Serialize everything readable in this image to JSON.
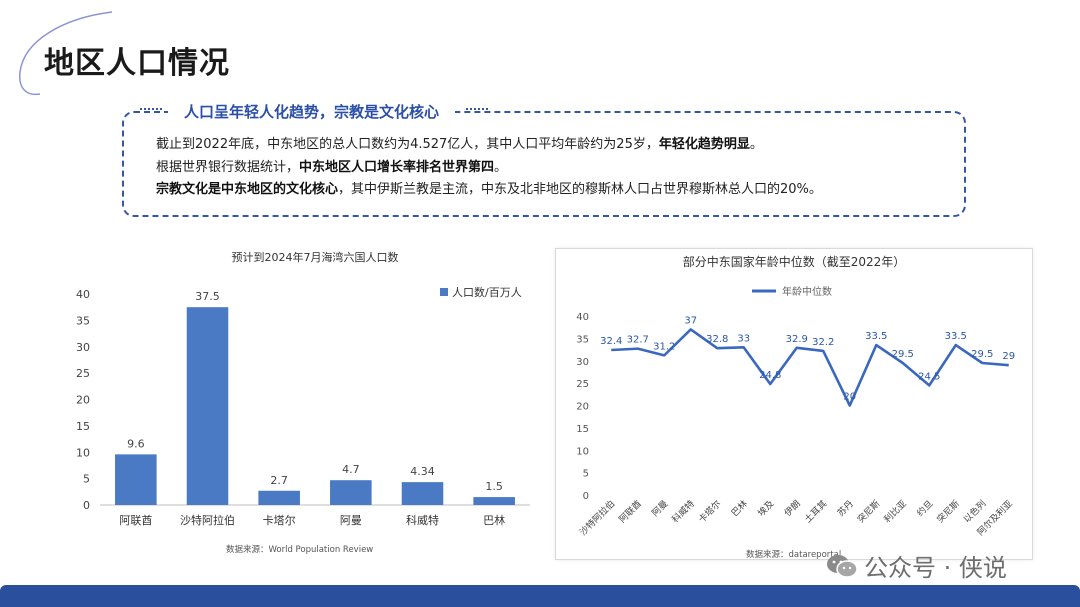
{
  "page": {
    "title": "地区人口情况"
  },
  "summary": {
    "heading": "人口呈年轻人化趋势，宗教是文化核心",
    "line1": {
      "a": "截止到2022年底，中东地区的总人口数约为4.527亿人，其中人口平均年龄约为25岁，",
      "b": "年轻化趋势明显",
      "c": "。"
    },
    "line2": {
      "a": "根据世界银行数据统计，",
      "b": "中东地区人口增长率排名世界第四",
      "c": "。"
    },
    "line3": {
      "a": "宗教文化是中东地区的文化核心",
      "b": "，其中伊斯兰教是主流，中东及北非地区的穆斯林人口占世界穆斯林总人口的20%。"
    }
  },
  "watermark": {
    "text": "公众号 · 侠说",
    "icon": "wechat-icon"
  },
  "colors": {
    "accent": "#4a7ac4",
    "line": "#3a68bf",
    "frame": "#3556a8",
    "footer": "#2a4f9c"
  },
  "chart_data": [
    {
      "type": "bar",
      "title": "预计到2024年7月海湾六国人口数",
      "categories": [
        "阿联酋",
        "沙特阿拉伯",
        "卡塔尔",
        "阿曼",
        "科威特",
        "巴林"
      ],
      "series": [
        {
          "name": "人口数/百万人",
          "values": [
            9.6,
            37.5,
            2.7,
            4.7,
            4.34,
            1.5
          ]
        }
      ],
      "value_labels": [
        "9.6",
        "37.5",
        "2.7",
        "4.7",
        "4.34",
        "1.5"
      ],
      "ylim": [
        0,
        40
      ],
      "yticks": [
        0,
        5,
        10,
        15,
        20,
        25,
        30,
        35,
        40
      ],
      "legend": "top-right",
      "source": "数据来源：World Population Review"
    },
    {
      "type": "line",
      "title": "部分中东国家年龄中位数（截至2022年）",
      "categories": [
        "沙特阿拉伯",
        "阿联酋",
        "阿曼",
        "科威特",
        "卡塔尔",
        "巴林",
        "埃及",
        "伊朗",
        "土耳其",
        "苏丹",
        "突尼斯",
        "利比亚",
        "约旦",
        "突尼斯",
        "以色列",
        "阿尔及利亚"
      ],
      "series": [
        {
          "name": "年龄中位数",
          "values": [
            32.4,
            32.7,
            31.2,
            37,
            32.8,
            33,
            24.8,
            32.9,
            32.2,
            20,
            33.5,
            29.5,
            24.5,
            33.5,
            29.5,
            29
          ]
        }
      ],
      "value_labels": [
        "32.4",
        "32.7",
        "31.2",
        "37",
        "32.8",
        "33",
        "24.8",
        "32.9",
        "32.2",
        "20",
        "33.5",
        "29.5",
        "24.5",
        "33.5",
        "29.5",
        "29"
      ],
      "ylim": [
        0,
        40
      ],
      "yticks": [
        0,
        5,
        10,
        15,
        20,
        25,
        30,
        35,
        40
      ],
      "legend": "top-center",
      "source": "数据来源：datareportal"
    }
  ]
}
